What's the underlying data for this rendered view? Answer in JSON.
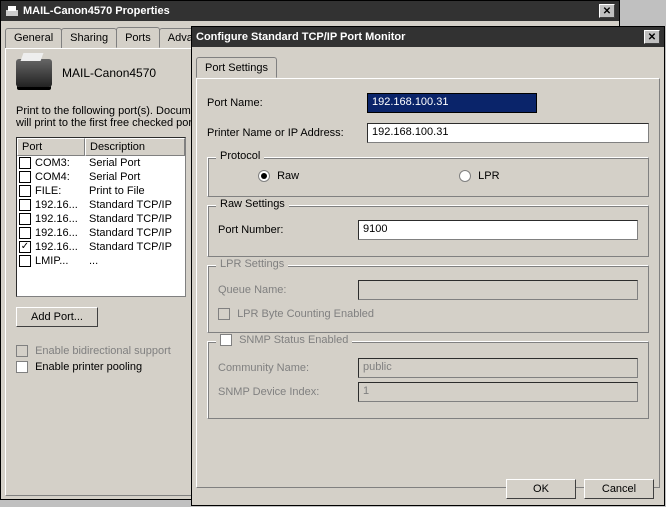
{
  "propWindow": {
    "title": "MAIL-Canon4570 Properties",
    "tabs": [
      "General",
      "Sharing",
      "Ports",
      "Advanced"
    ],
    "activeTab": 2,
    "printerName": "MAIL-Canon4570",
    "instruction": "Print to the following port(s). Documents will print to the first free checked port.",
    "columns": {
      "port": "Port",
      "desc": "Description"
    },
    "ports": [
      {
        "checked": false,
        "port": "COM3:",
        "desc": "Serial Port"
      },
      {
        "checked": false,
        "port": "COM4:",
        "desc": "Serial Port"
      },
      {
        "checked": false,
        "port": "FILE:",
        "desc": "Print to File"
      },
      {
        "checked": false,
        "port": "192.16...",
        "desc": "Standard TCP/IP"
      },
      {
        "checked": false,
        "port": "192.16...",
        "desc": "Standard TCP/IP"
      },
      {
        "checked": false,
        "port": "192.16...",
        "desc": "Standard TCP/IP"
      },
      {
        "checked": true,
        "port": "192.16...",
        "desc": "Standard TCP/IP"
      },
      {
        "checked": false,
        "port": "LMIP...",
        "desc": "..."
      }
    ],
    "addPort": "Add Port...",
    "bidi": "Enable bidirectional support",
    "pooling": "Enable printer pooling"
  },
  "configWindow": {
    "title": "Configure Standard TCP/IP Port Monitor",
    "tab": "Port Settings",
    "portNameLabel": "Port Name:",
    "portName": "192.168.100.31",
    "addrLabel": "Printer Name or IP Address:",
    "addr": "192.168.100.31",
    "protocol": {
      "legend": "Protocol",
      "raw": "Raw",
      "lpr": "LPR",
      "selected": "raw"
    },
    "rawGroup": {
      "legend": "Raw Settings",
      "portNumLabel": "Port Number:",
      "portNum": "9100"
    },
    "lprGroup": {
      "legend": "LPR Settings",
      "queueLabel": "Queue Name:",
      "queue": "",
      "byteCount": "LPR Byte Counting Enabled"
    },
    "snmpGroup": {
      "legend": "SNMP Status Enabled",
      "community": "Community Name:",
      "communityVal": "public",
      "devIndex": "SNMP Device Index:",
      "devIndexVal": "1"
    },
    "ok": "OK",
    "cancel": "Cancel"
  }
}
